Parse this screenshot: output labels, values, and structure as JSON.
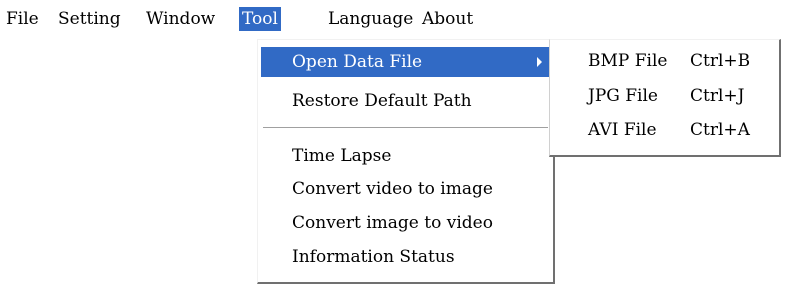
{
  "menubar": {
    "items": [
      {
        "label": "File"
      },
      {
        "label": "Setting"
      },
      {
        "label": "Window"
      },
      {
        "label": "Tool"
      },
      {
        "label": "Language"
      },
      {
        "label": "About"
      }
    ],
    "active": "Tool"
  },
  "tool_menu": {
    "items": [
      {
        "label": "Open Data File",
        "highlighted": true,
        "has_submenu": true
      },
      {
        "label": "Restore Default Path"
      },
      {
        "label": "Time Lapse"
      },
      {
        "label": "Convert video to image"
      },
      {
        "label": "Convert image to video"
      },
      {
        "label": "Information Status"
      }
    ]
  },
  "open_data_file_submenu": {
    "items": [
      {
        "label": "BMP File",
        "shortcut": "Ctrl+B"
      },
      {
        "label": "JPG File",
        "shortcut": "Ctrl+J"
      },
      {
        "label": "AVI File",
        "shortcut": "Ctrl+A"
      }
    ]
  },
  "colors": {
    "highlight": "#316ac5",
    "highlight_text": "#ffffff",
    "menu_background": "#ffffff",
    "menu_border_shadow": "#707070"
  }
}
